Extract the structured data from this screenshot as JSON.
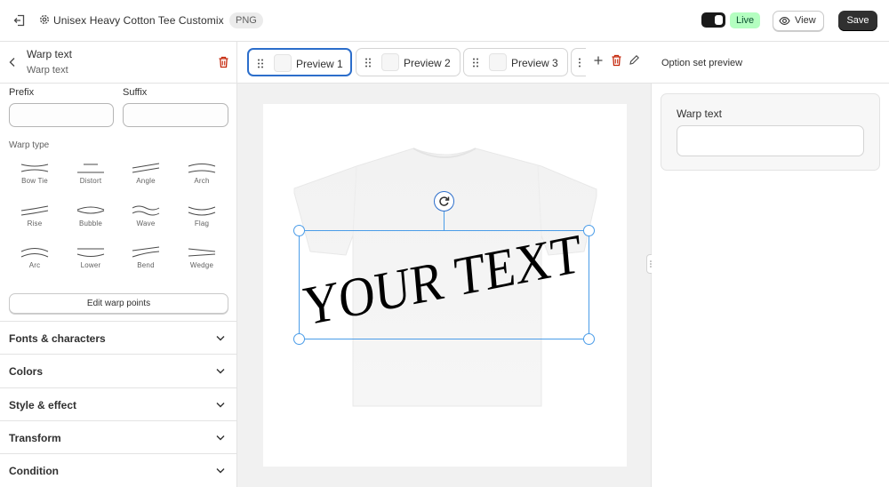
{
  "topbar": {
    "title": "Unisex Heavy Cotton Tee Customix",
    "format_badge": "PNG",
    "live_badge": "Live",
    "view_label": "View",
    "save_label": "Save",
    "icons": [
      "exit-icon",
      "gear-icon",
      "toggle-icon",
      "eye-icon"
    ]
  },
  "left_panel": {
    "title": "Warp text",
    "subtitle": "Warp text",
    "prefix_label": "Prefix",
    "prefix_value": "",
    "suffix_label": "Suffix",
    "suffix_value": "",
    "warp_type_label": "Warp type",
    "warp_types": [
      "Bow Tie",
      "Distort",
      "Angle",
      "Arch",
      "Rise",
      "Bubble",
      "Wave",
      "Flag",
      "Arc",
      "Lower",
      "Bend",
      "Wedge"
    ],
    "edit_warp_points_label": "Edit warp points",
    "sections": [
      "Fonts & characters",
      "Colors",
      "Style & effect",
      "Transform",
      "Condition"
    ]
  },
  "canvas": {
    "tabs": [
      {
        "label": "Preview 1",
        "active": true
      },
      {
        "label": "Preview 2",
        "active": false
      },
      {
        "label": "Preview 3",
        "active": false
      }
    ],
    "design_text": "YOUR TEXT",
    "accent_color": "#2c6ecb",
    "selection_color": "#4a9ce8"
  },
  "right_panel": {
    "title": "Option set preview",
    "field_label": "Warp text",
    "field_value": ""
  },
  "colors": {
    "danger": "#c5280c",
    "live_bg": "#b4fec0",
    "live_text": "#0c5132",
    "dark": "#303030"
  }
}
